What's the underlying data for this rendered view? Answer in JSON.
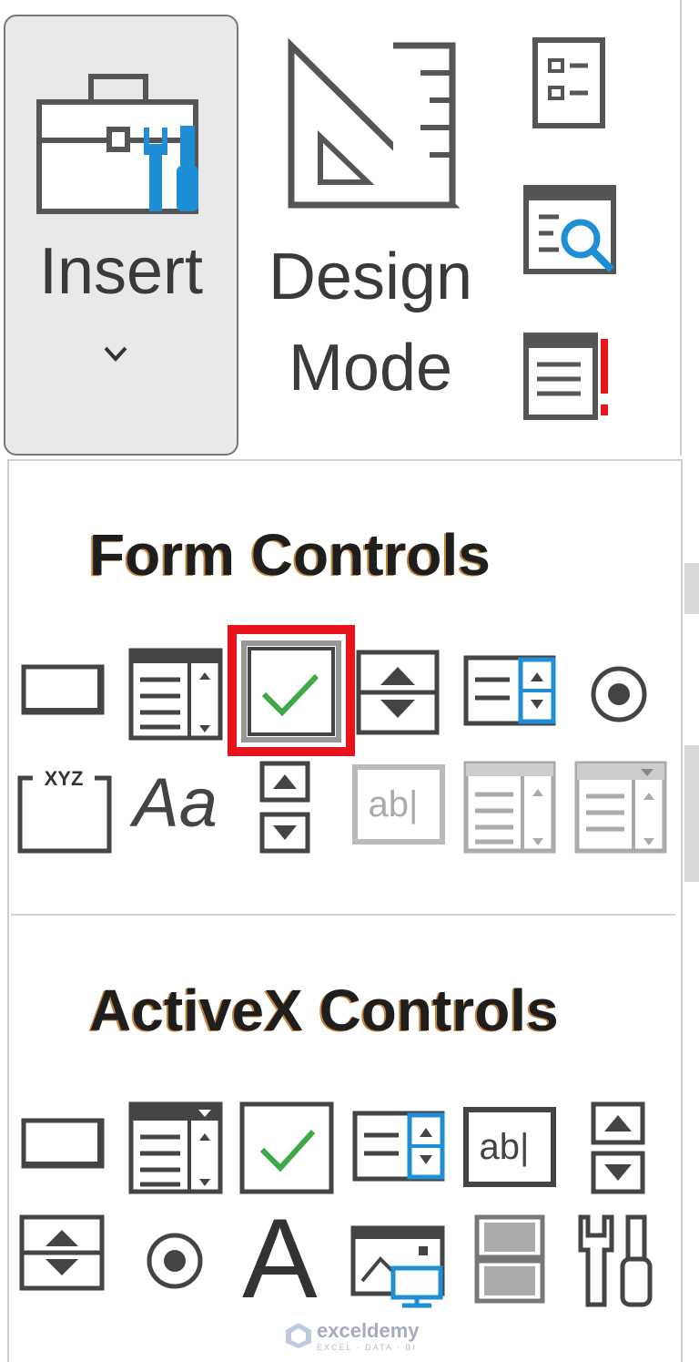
{
  "ribbon": {
    "insert_label": "Insert",
    "design_line1": "Design",
    "design_line2": "Mode"
  },
  "menu": {
    "form_controls_title": "Form Controls",
    "activex_controls_title": "ActiveX Controls",
    "highlighted_control": "check-box",
    "highlight_color": "#e8141b"
  },
  "labels": {
    "xyz": "XYZ",
    "aa": "Aa",
    "abl": "ab|",
    "letter_a": "A"
  },
  "watermark": {
    "name": "exceldemy",
    "tagline": "EXCEL · DATA · BI"
  },
  "colors": {
    "accent_blue": "#1e8fd6",
    "check_green": "#3daa4a",
    "icon_gray": "#444444",
    "disabled_gray": "#a9a9a9"
  }
}
